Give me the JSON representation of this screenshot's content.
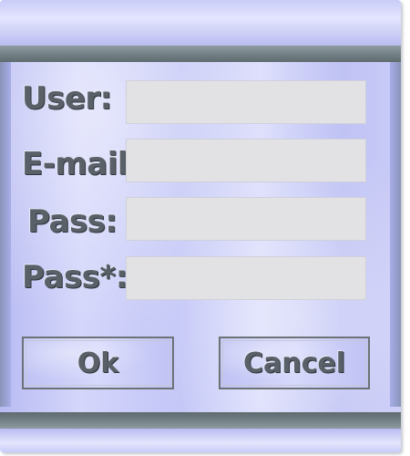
{
  "form": {
    "fields": [
      {
        "label": "User:",
        "value": "",
        "placeholder": ""
      },
      {
        "label": "E-mail:",
        "value": "",
        "placeholder": ""
      },
      {
        "label": "Pass:",
        "value": "",
        "placeholder": ""
      },
      {
        "label": "Pass*:",
        "value": "",
        "placeholder": ""
      }
    ],
    "buttons": {
      "ok_label": "Ok",
      "cancel_label": "Cancel"
    }
  },
  "colors": {
    "panel": "#c9cbf7",
    "bar": "#6f7d82",
    "input_bg": "#e2e2e5",
    "label_text": "#5a6068"
  }
}
